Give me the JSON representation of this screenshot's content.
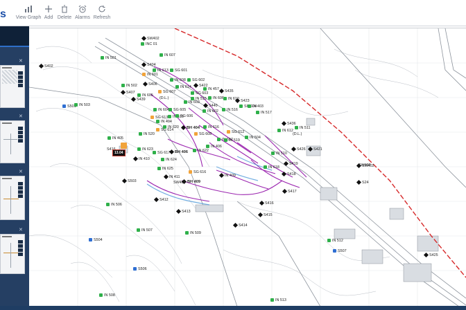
{
  "brand": {
    "text": "s"
  },
  "toolbar": {
    "view_graph": "View Graph",
    "add": "Add",
    "delete": "Delete",
    "alarms": "Alarms",
    "refresh": "Refresh"
  },
  "icons": {
    "view_graph": "bar-chart-icon",
    "add": "plus-icon",
    "delete": "trash-icon",
    "alarms": "alarm-clock-icon",
    "refresh": "refresh-icon"
  },
  "colors": {
    "header": "#0f2138",
    "panel": "#253f63",
    "accent": "#2f6fc9",
    "boundary": "#d62728",
    "section_lines": "#9c27b0",
    "marker_green": "#2fb04a",
    "marker_orange": "#f1a33a",
    "marker_blue": "#2f6fd3",
    "alarm_badge": "#c0392b"
  },
  "alarm_badge": "13.04",
  "map_labels": [
    "SW402",
    "INC 01",
    "IN 607",
    "IN 501",
    "S404",
    "IN 613",
    "SG 601",
    "S402",
    "IN 601",
    "S406",
    "IN 608",
    "SG 602",
    "S407",
    "SG 607",
    "IN 614",
    "IN 502",
    "IN 605",
    "(D.L.)",
    "SG 603",
    "IN 603",
    "S422",
    "S435",
    "IN 457",
    "IN 515",
    "IN 606",
    "S439",
    "IN 604",
    "SG 605",
    "IN 610",
    "S440",
    "S423",
    "SG 604",
    "IN 403",
    "IN 602",
    "IN 516",
    "IN 517",
    "S501",
    "IN 503",
    "IN 615",
    "SG 606",
    "SG 613",
    "IN 404",
    "IN 616",
    "S436",
    "IN 511",
    "SG 614",
    "IN 620",
    "BH 404",
    "IN 612",
    "SG 608",
    "SG 612",
    "IN 504",
    "IN 405",
    "IN 520",
    "IN 617",
    "S426",
    "S421",
    "S416",
    "IN 623",
    "BH 406",
    "IN 622",
    "IN 406",
    "IN 519",
    "IN 510",
    "SG 617",
    "IN 410",
    "IN 624",
    "SG 616",
    "SW402",
    "IN 618",
    "S419",
    "SW403",
    "S503",
    "IN 625",
    "IN 409",
    "S418",
    "IN 411",
    "BH 409",
    "SW405",
    "IN 506",
    "S412",
    "S416",
    "S417",
    "S413",
    "S414",
    "S415",
    "IN 507",
    "IN 509",
    "S504",
    "IN 512",
    "S507",
    "S425",
    "S506",
    "IN 508",
    "IN 513",
    "S24",
    "(D.L.)"
  ]
}
